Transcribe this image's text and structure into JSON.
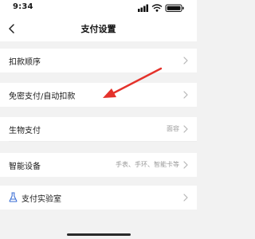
{
  "status_bar": {
    "time": "9:34",
    "icons": [
      "location-arrow-icon",
      "signal-icon",
      "wifi-icon",
      "battery-icon"
    ]
  },
  "nav": {
    "title": "支付设置",
    "back_icon": "chevron-left-icon"
  },
  "rows": {
    "deduct_order": {
      "label": "扣款顺序"
    },
    "auto_pay": {
      "label": "免密支付/自动扣款"
    },
    "biometric": {
      "label": "生物支付",
      "value": "面容"
    },
    "smart_device": {
      "label": "智能设备",
      "value": "手表、手环、智能卡等"
    },
    "lab": {
      "label": "支付实验室",
      "icon": "flask-icon"
    }
  },
  "annotation": {
    "color": "#e4322b",
    "icon": "red-arrow-annotation"
  }
}
